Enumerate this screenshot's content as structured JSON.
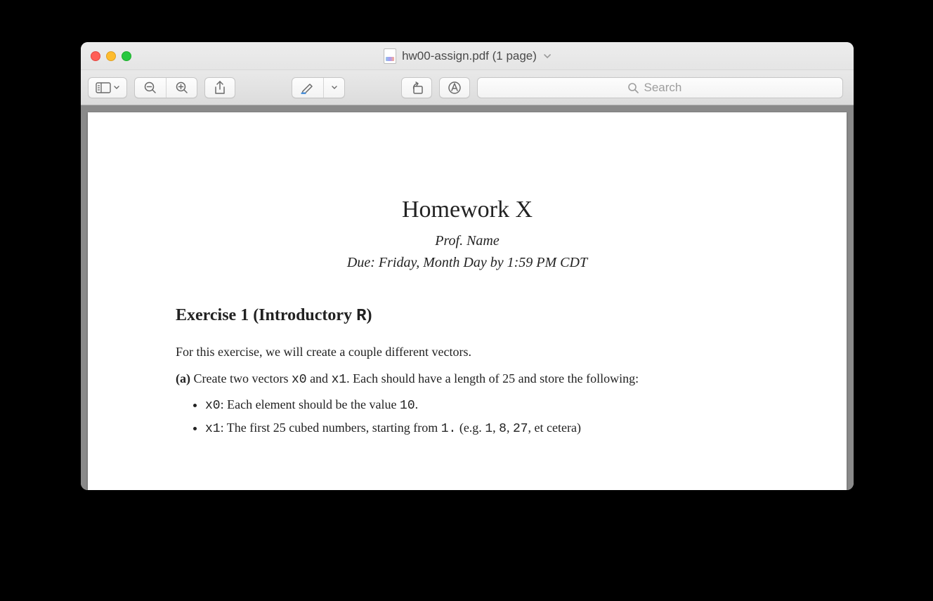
{
  "window": {
    "title": "hw00-assign.pdf (1 page)"
  },
  "toolbar": {
    "search_placeholder": "Search"
  },
  "document": {
    "title": "Homework X",
    "subtitle": "Prof. Name",
    "due": "Due: Friday, Month Day by 1:59 PM CDT",
    "exercise_heading_prefix": "Exercise 1 (Introductory ",
    "exercise_heading_code": "R",
    "exercise_heading_suffix": ")",
    "intro_text": "For this exercise, we will create a couple different vectors.",
    "part_a_label": "(a)",
    "part_a_pre": " Create two vectors ",
    "part_a_x0": "x0",
    "part_a_and": " and ",
    "part_a_x1": "x1",
    "part_a_post": ". Each should have a length of 25 and store the following:",
    "bullet1_code": "x0",
    "bullet1_pre": ": Each element should be the value ",
    "bullet1_val": "10",
    "bullet1_post": ".",
    "bullet2_code": "x1",
    "bullet2_pre": ": The first 25 cubed numbers, starting from ",
    "bullet2_val1": "1.",
    "bullet2_mid": " (e.g. ",
    "bullet2_v1": "1",
    "bullet2_c1": ", ",
    "bullet2_v2": "8",
    "bullet2_c2": ", ",
    "bullet2_v3": "27",
    "bullet2_post": ", et cetera)"
  }
}
